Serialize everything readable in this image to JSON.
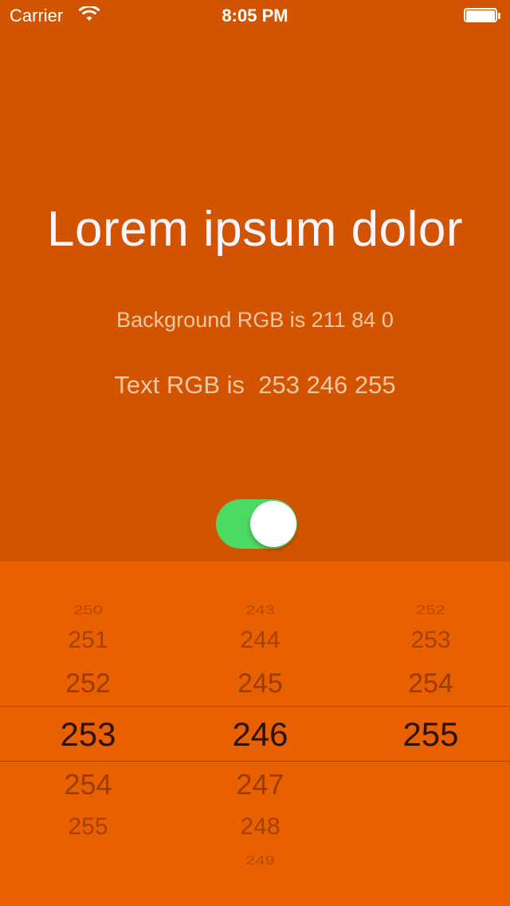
{
  "status_bar": {
    "carrier": "Carrier",
    "time": "8:05 PM"
  },
  "main": {
    "headline": "Lorem ipsum dolor",
    "background_rgb_text": "Background RGB is 211 84 0",
    "text_rgb_text": "Text RGB is  253 246 255",
    "toggle_on": true
  },
  "picker": {
    "columns": [
      {
        "items": [
          "250",
          "251",
          "252",
          "253",
          "254",
          "255"
        ],
        "selected": "253"
      },
      {
        "items": [
          "243",
          "244",
          "245",
          "246",
          "247",
          "248",
          "249"
        ],
        "selected": "246"
      },
      {
        "items": [
          "252",
          "253",
          "254",
          "255"
        ],
        "selected": "255"
      }
    ]
  },
  "colors": {
    "background": "#d35400",
    "text": "#fdf6ff",
    "picker_background": "#e86000",
    "toggle_on": "#4cd964"
  },
  "icons": [
    "wifi-icon",
    "battery-icon"
  ]
}
